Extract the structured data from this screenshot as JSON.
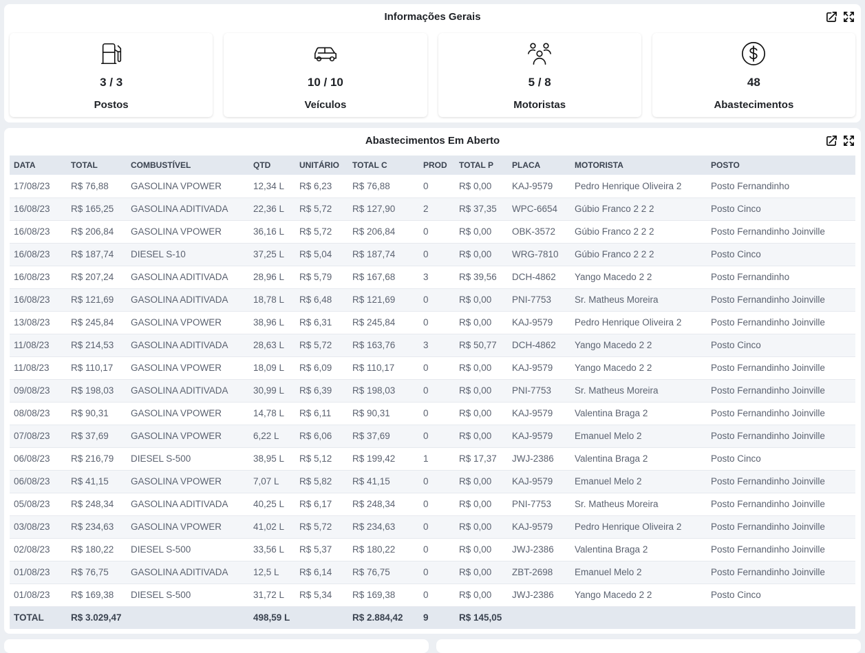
{
  "info_panel": {
    "title": "Informações Gerais",
    "cards": [
      {
        "icon": "fuel-pump-icon",
        "value": "3 / 3",
        "label": "Postos"
      },
      {
        "icon": "car-icon",
        "value": "10 / 10",
        "label": "Veículos"
      },
      {
        "icon": "users-icon",
        "value": "5 / 8",
        "label": "Motoristas"
      },
      {
        "icon": "dollar-icon",
        "value": "48",
        "label": "Abastecimentos"
      }
    ]
  },
  "table_panel": {
    "title": "Abastecimentos Em Aberto",
    "columns": [
      "DATA",
      "TOTAL",
      "COMBUSTÍVEL",
      "QTD",
      "UNITÁRIO",
      "TOTAL C",
      "PROD",
      "TOTAL P",
      "PLACA",
      "MOTORISTA",
      "POSTO"
    ],
    "rows": [
      [
        "17/08/23",
        "R$ 76,88",
        "GASOLINA VPOWER",
        "12,34 L",
        "R$ 6,23",
        "R$ 76,88",
        "0",
        "R$ 0,00",
        "KAJ-9579",
        "Pedro Henrique Oliveira 2",
        "Posto Fernandinho"
      ],
      [
        "16/08/23",
        "R$ 165,25",
        "GASOLINA ADITIVADA",
        "22,36 L",
        "R$ 5,72",
        "R$ 127,90",
        "2",
        "R$ 37,35",
        "WPC-6654",
        "Gúbio Franco 2 2 2",
        "Posto Cinco"
      ],
      [
        "16/08/23",
        "R$ 206,84",
        "GASOLINA VPOWER",
        "36,16 L",
        "R$ 5,72",
        "R$ 206,84",
        "0",
        "R$ 0,00",
        "OBK-3572",
        "Gúbio Franco 2 2 2",
        "Posto Fernandinho Joinville"
      ],
      [
        "16/08/23",
        "R$ 187,74",
        "DIESEL S-10",
        "37,25 L",
        "R$ 5,04",
        "R$ 187,74",
        "0",
        "R$ 0,00",
        "WRG-7810",
        "Gúbio Franco 2 2 2",
        "Posto Cinco"
      ],
      [
        "16/08/23",
        "R$ 207,24",
        "GASOLINA ADITIVADA",
        "28,96 L",
        "R$ 5,79",
        "R$ 167,68",
        "3",
        "R$ 39,56",
        "DCH-4862",
        "Yango Macedo 2 2",
        "Posto Fernandinho"
      ],
      [
        "16/08/23",
        "R$ 121,69",
        "GASOLINA ADITIVADA",
        "18,78 L",
        "R$ 6,48",
        "R$ 121,69",
        "0",
        "R$ 0,00",
        "PNI-7753",
        "Sr. Matheus Moreira",
        "Posto Fernandinho Joinville"
      ],
      [
        "13/08/23",
        "R$ 245,84",
        "GASOLINA VPOWER",
        "38,96 L",
        "R$ 6,31",
        "R$ 245,84",
        "0",
        "R$ 0,00",
        "KAJ-9579",
        "Pedro Henrique Oliveira 2",
        "Posto Fernandinho Joinville"
      ],
      [
        "11/08/23",
        "R$ 214,53",
        "GASOLINA ADITIVADA",
        "28,63 L",
        "R$ 5,72",
        "R$ 163,76",
        "3",
        "R$ 50,77",
        "DCH-4862",
        "Yango Macedo 2 2",
        "Posto Cinco"
      ],
      [
        "11/08/23",
        "R$ 110,17",
        "GASOLINA VPOWER",
        "18,09 L",
        "R$ 6,09",
        "R$ 110,17",
        "0",
        "R$ 0,00",
        "KAJ-9579",
        "Yango Macedo 2 2",
        "Posto Fernandinho Joinville"
      ],
      [
        "09/08/23",
        "R$ 198,03",
        "GASOLINA ADITIVADA",
        "30,99 L",
        "R$ 6,39",
        "R$ 198,03",
        "0",
        "R$ 0,00",
        "PNI-7753",
        "Sr. Matheus Moreira",
        "Posto Fernandinho Joinville"
      ],
      [
        "08/08/23",
        "R$ 90,31",
        "GASOLINA VPOWER",
        "14,78 L",
        "R$ 6,11",
        "R$ 90,31",
        "0",
        "R$ 0,00",
        "KAJ-9579",
        "Valentina Braga 2",
        "Posto Fernandinho Joinville"
      ],
      [
        "07/08/23",
        "R$ 37,69",
        "GASOLINA VPOWER",
        "6,22 L",
        "R$ 6,06",
        "R$ 37,69",
        "0",
        "R$ 0,00",
        "KAJ-9579",
        "Emanuel Melo 2",
        "Posto Fernandinho Joinville"
      ],
      [
        "06/08/23",
        "R$ 216,79",
        "DIESEL S-500",
        "38,95 L",
        "R$ 5,12",
        "R$ 199,42",
        "1",
        "R$ 17,37",
        "JWJ-2386",
        "Valentina Braga 2",
        "Posto Cinco"
      ],
      [
        "06/08/23",
        "R$ 41,15",
        "GASOLINA VPOWER",
        "7,07 L",
        "R$ 5,82",
        "R$ 41,15",
        "0",
        "R$ 0,00",
        "KAJ-9579",
        "Emanuel Melo 2",
        "Posto Fernandinho Joinville"
      ],
      [
        "05/08/23",
        "R$ 248,34",
        "GASOLINA ADITIVADA",
        "40,25 L",
        "R$ 6,17",
        "R$ 248,34",
        "0",
        "R$ 0,00",
        "PNI-7753",
        "Sr. Matheus Moreira",
        "Posto Fernandinho Joinville"
      ],
      [
        "03/08/23",
        "R$ 234,63",
        "GASOLINA VPOWER",
        "41,02 L",
        "R$ 5,72",
        "R$ 234,63",
        "0",
        "R$ 0,00",
        "KAJ-9579",
        "Pedro Henrique Oliveira 2",
        "Posto Fernandinho Joinville"
      ],
      [
        "02/08/23",
        "R$ 180,22",
        "DIESEL S-500",
        "33,56 L",
        "R$ 5,37",
        "R$ 180,22",
        "0",
        "R$ 0,00",
        "JWJ-2386",
        "Valentina Braga 2",
        "Posto Fernandinho Joinville"
      ],
      [
        "01/08/23",
        "R$ 76,75",
        "GASOLINA ADITIVADA",
        "12,5 L",
        "R$ 6,14",
        "R$ 76,75",
        "0",
        "R$ 0,00",
        "ZBT-2698",
        "Emanuel Melo 2",
        "Posto Fernandinho Joinville"
      ],
      [
        "01/08/23",
        "R$ 169,38",
        "DIESEL S-500",
        "31,72 L",
        "R$ 5,34",
        "R$ 169,38",
        "0",
        "R$ 0,00",
        "JWJ-2386",
        "Yango Macedo 2 2",
        "Posto Cinco"
      ]
    ],
    "totals": [
      "TOTAL",
      "R$ 3.029,47",
      "",
      "498,59 L",
      "",
      "R$ 2.884,42",
      "9",
      "R$ 145,05",
      "",
      "",
      ""
    ]
  },
  "icons": {
    "open_external": "open-external-icon",
    "fullscreen": "fullscreen-icon"
  }
}
